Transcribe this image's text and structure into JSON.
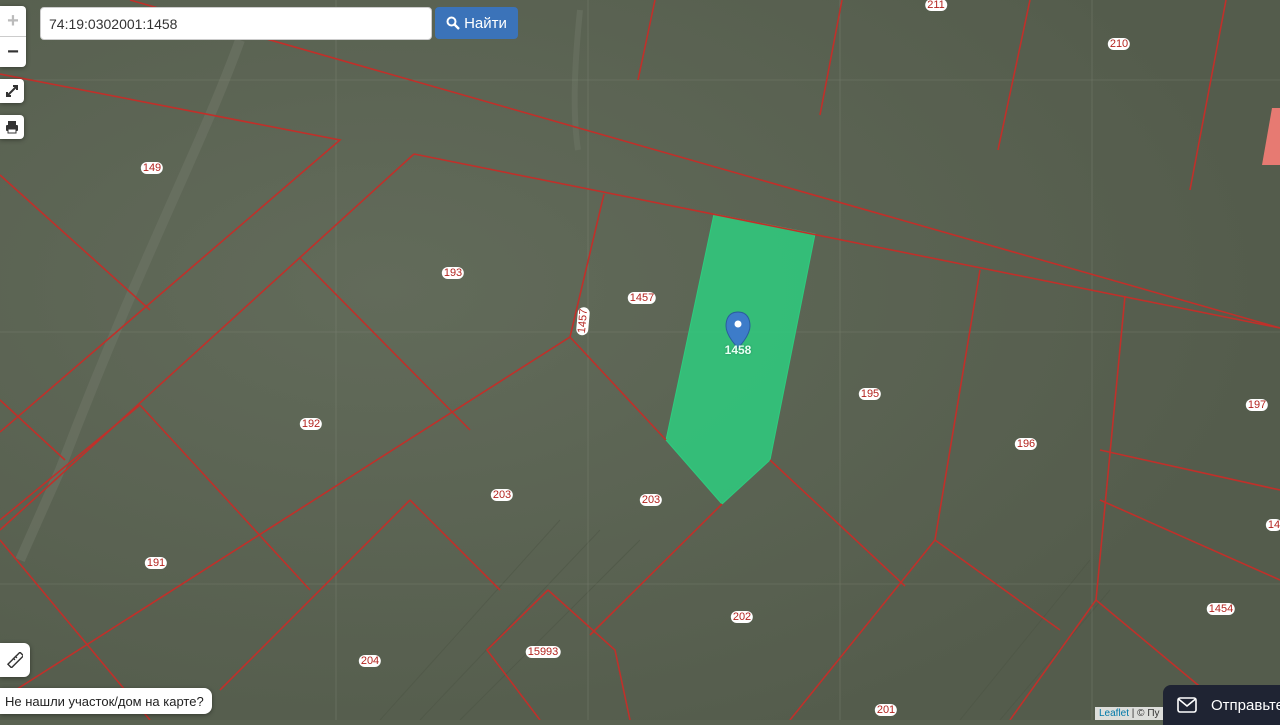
{
  "search": {
    "value": "74:19:0302001:1458",
    "button_label": "Найти"
  },
  "zoom": {
    "in_label": "+",
    "out_label": "−"
  },
  "parcels": {
    "selected": "1458",
    "labels": [
      "211",
      "210",
      "149",
      "193",
      "1457",
      "1458",
      "195",
      "197",
      "196",
      "192",
      "203",
      "203",
      "191",
      "202",
      "1454",
      "15993",
      "204",
      "201",
      "14"
    ]
  },
  "footer": {
    "not_found_label": "Не нашли участок/дом на карте?",
    "attribution_leaflet": "Leaflet",
    "attribution_rest": " | © Пу",
    "send_label": "Отправьте"
  },
  "colors": {
    "parcel_border": "#c0302a",
    "selected_fill": "#2ecc7f",
    "search_button": "#3b73b9",
    "send_panel": "#1f2433",
    "marker": "#3d7cc9"
  }
}
